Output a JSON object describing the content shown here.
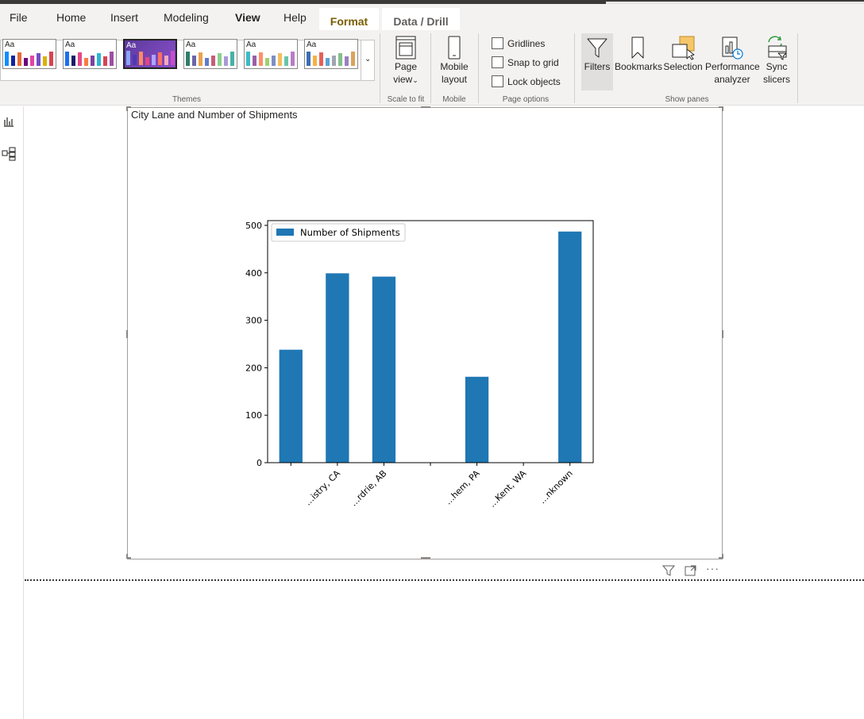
{
  "menu": {
    "tabs": [
      "File",
      "Home",
      "Insert",
      "Modeling",
      "View",
      "Help"
    ],
    "active_tab": "View",
    "context_tabs": [
      "Format",
      "Data / Drill"
    ]
  },
  "ribbon": {
    "theme_sample_label": "Aa",
    "groups": {
      "themes": "Themes",
      "scale": "Scale to fit",
      "mobile": "Mobile",
      "page_options": "Page options",
      "show_panes": "Show panes"
    },
    "page_view": {
      "line1": "Page",
      "line2": "view"
    },
    "mobile_layout": {
      "line1": "Mobile",
      "line2": "layout"
    },
    "checkboxes": [
      "Gridlines",
      "Snap to grid",
      "Lock objects"
    ],
    "panes": {
      "filters": "Filters",
      "bookmarks": "Bookmarks",
      "selection": "Selection",
      "performance_line1": "Performance",
      "performance_line2": "analyzer",
      "sync_line1": "Sync",
      "sync_line2": "slicers"
    }
  },
  "theme_colors": [
    [
      "#118dff",
      "#12239e",
      "#e66c37",
      "#6b007b",
      "#e044a7",
      "#744ec2",
      "#d9b300",
      "#d64550"
    ],
    [
      "#1c6ef2",
      "#1b1e6b",
      "#e44987",
      "#fa7b3f",
      "#7843a0",
      "#2bb7d3",
      "#d64550",
      "#9d4ea1"
    ],
    [
      "#8aa4f8",
      "#4e3ab3",
      "#ff8a65",
      "#e7447c",
      "#b1a2ff",
      "#ff6f61",
      "#f7a8b8",
      "#c84cce"
    ],
    [
      "#2c7c6c",
      "#6c63a8",
      "#e9a34b",
      "#5f7cc8",
      "#c65c7b",
      "#8ad18b",
      "#a89bd6",
      "#48b1a7"
    ],
    [
      "#3ebac6",
      "#9c5ea6",
      "#ff8f6b",
      "#a0d16e",
      "#7e8fc2",
      "#f3be5c",
      "#69c6a5",
      "#b97cc8"
    ],
    [
      "#3b6db5",
      "#f6b142",
      "#e56159",
      "#58a4d4",
      "#a0a7b2",
      "#84c08c",
      "#9c7ec1",
      "#d9a45b"
    ]
  ],
  "visual": {
    "title": "City Lane and Number of Shipments"
  },
  "chart_data": {
    "type": "bar",
    "categories": [
      "",
      "…istry, CA",
      "…rdrie, AB",
      "",
      "…hem, PA",
      "…Kent, WA",
      "…nknown"
    ],
    "series": [
      {
        "name": "Number of Shipments",
        "values": [
          238,
          399,
          392,
          null,
          181,
          null,
          487
        ]
      }
    ],
    "ylim": [
      0,
      510
    ],
    "yticks": [
      0,
      100,
      200,
      300,
      400,
      500
    ],
    "legend": "top-left",
    "color": "#1f77b4",
    "grid": false
  }
}
